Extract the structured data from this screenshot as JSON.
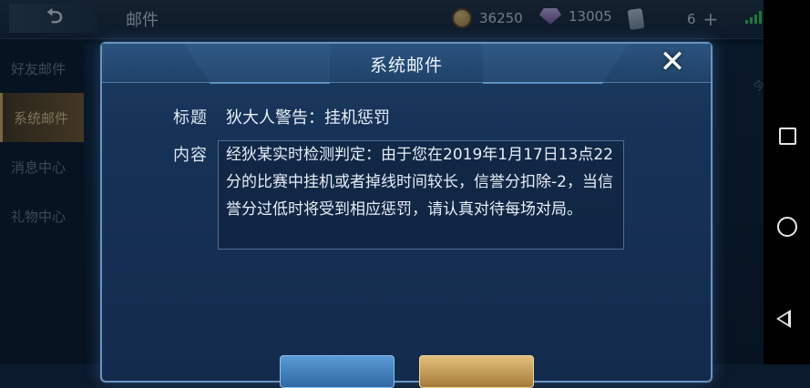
{
  "topbar": {
    "back_icon": "back-arrow-icon",
    "title": "邮件",
    "gold": "36250",
    "diamonds": "13005",
    "vouchers": "6",
    "plus": "+"
  },
  "sidebar": {
    "items": [
      {
        "label": "好友邮件",
        "active": false
      },
      {
        "label": "系统邮件",
        "active": true
      },
      {
        "label": "消息中心",
        "active": false
      },
      {
        "label": "礼物中心",
        "active": false
      }
    ]
  },
  "list": {
    "date_label": "今天"
  },
  "modal": {
    "title": "系统邮件",
    "close_icon": "close-icon",
    "subject_label": "标题",
    "subject_value": "狄大人警告：挂机惩罚",
    "content_label": "内容",
    "content_value": "经狄某实时检测判定：由于您在2019年1月17日13点22分的比赛中挂机或者掉线时间较长，信誉分扣除-2，当信誉分过低时将受到相应惩罚，请认真对待每场对局。"
  },
  "colors": {
    "accent_gold": "#d9b067",
    "modal_border": "#6a93bf",
    "signal_green": "#3ccf57"
  }
}
